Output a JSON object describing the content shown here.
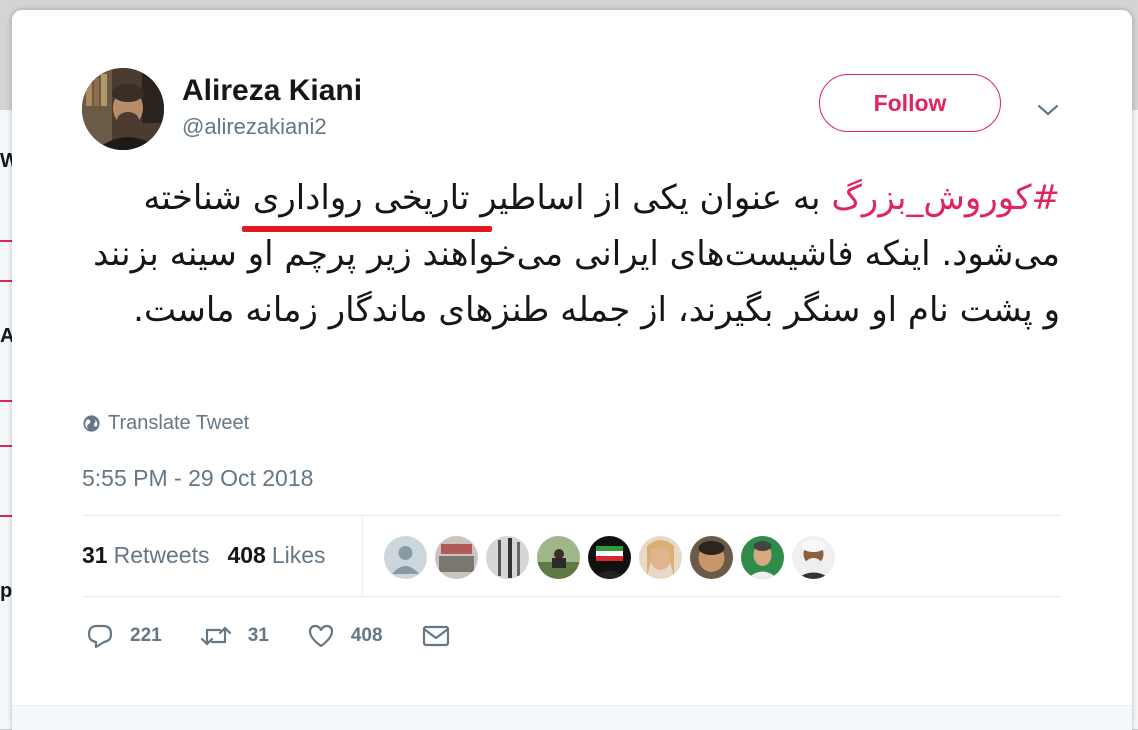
{
  "user": {
    "name": "Alireza Kiani",
    "handle": "@alirezakiani2"
  },
  "follow_label": "Follow",
  "tweet": {
    "hashtag": "#کوروش_بزرگ",
    "body": "  به عنوان یکی از اساطیر تاریخی رواداری شناخته می‌شود. اینکه فاشیست‌های ایرانی می‌خواهند زیر پرچم او سینه بزنند و پشت نام او سنگر بگیرند، از جمله طنزهای ماندگار زمانه ماست."
  },
  "translate_label": "Translate Tweet",
  "timestamp": "5:55 PM - 29 Oct 2018",
  "stats": {
    "retweets_count": "31",
    "retweets_label": "Retweets",
    "likes_count": "408",
    "likes_label": "Likes"
  },
  "actions": {
    "reply_count": "221",
    "retweet_count": "31",
    "like_count": "408"
  },
  "icons": {
    "globe": "globe-icon",
    "caret": "chevron-down-icon",
    "reply": "reply-icon",
    "retweet": "retweet-icon",
    "like": "heart-icon",
    "dm": "envelope-icon"
  },
  "colors": {
    "accent": "#e0245e",
    "secondary_text": "#657786",
    "primary_text": "#14171a",
    "annotation_underline": "#e0191e"
  }
}
